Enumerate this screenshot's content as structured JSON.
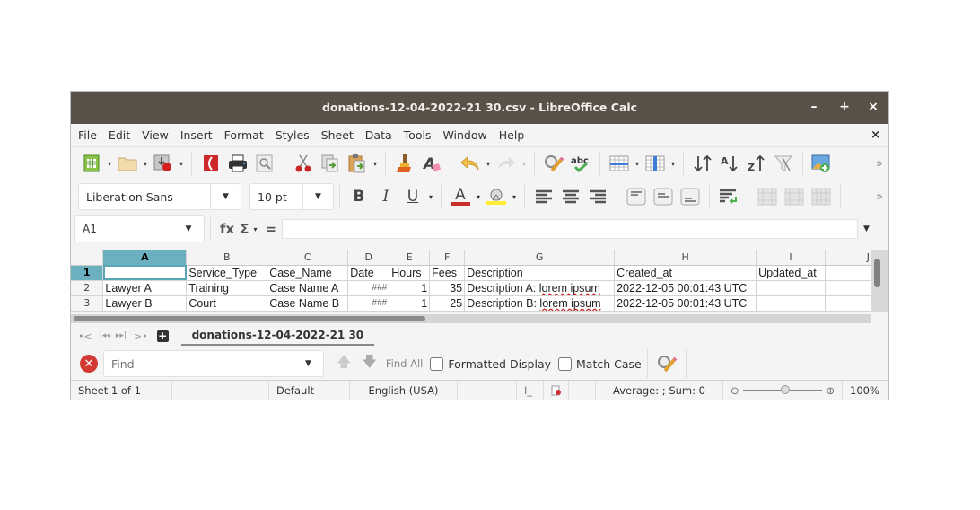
{
  "window": {
    "title": "donations-12-04-2022-21 30.csv - LibreOffice Calc",
    "minimize_label": "–",
    "maximize_label": "+",
    "close_label": "×"
  },
  "menubar": {
    "items": [
      "File",
      "Edit",
      "View",
      "Insert",
      "Format",
      "Styles",
      "Sheet",
      "Data",
      "Tools",
      "Window",
      "Help"
    ],
    "close_doc_label": "×"
  },
  "toolbar": {
    "standard_icons": [
      "new-spreadsheet-icon",
      "open-folder-icon",
      "save-icon",
      "export-pdf-icon",
      "print-icon",
      "print-preview-icon",
      "cut-icon",
      "copy-icon",
      "paste-icon",
      "clone-formatting-icon",
      "clear-formatting-icon",
      "undo-icon",
      "redo-icon",
      "find-replace-icon",
      "spellcheck-icon",
      "row-icon",
      "column-icon",
      "sort-icon",
      "sort-ascending-icon",
      "sort-descending-icon",
      "autofilter-icon",
      "insert-image-icon"
    ],
    "more_label": "»"
  },
  "formatting": {
    "font_name": "Liberation Sans",
    "font_size": "10 pt",
    "bold_label": "B",
    "italic_label": "I",
    "underline_label": "U",
    "font_color_label": "A",
    "font_color": "#c9302c",
    "highlight_color": "#ffee33",
    "more_label": "»"
  },
  "formula_bar": {
    "name_box": "A1",
    "fx_label": "fx",
    "sum_label": "Σ",
    "equals_label": "=",
    "formula": ""
  },
  "sheet": {
    "columns": [
      "A",
      "B",
      "C",
      "D",
      "E",
      "F",
      "G",
      "H",
      "I",
      "J"
    ],
    "rows": [
      {
        "num": "1",
        "cells": [
          "",
          "Service_Type",
          "Case_Name",
          "Date",
          "Hours",
          "Fees",
          "Description",
          "Created_at",
          "Updated_at",
          ""
        ]
      },
      {
        "num": "2",
        "cells": [
          "Lawyer A",
          "Training",
          "Case Name A",
          "###",
          "1",
          "35",
          "Description A: lorem ipsum",
          "2022-12-05 00:01:43 UTC",
          "",
          ""
        ]
      },
      {
        "num": "3",
        "cells": [
          "Lawyer B",
          "Court",
          "Case Name B",
          "###",
          "1",
          "25",
          "Description B: lorem ipsum",
          "2022-12-05 00:01:43 UTC",
          "",
          ""
        ]
      }
    ],
    "active_cell": "A1",
    "selected_column": "A",
    "selected_row": "1",
    "selection_color": "#6ab0be"
  },
  "tabs": {
    "nav": [
      "•<",
      "|◂◂",
      "▸▸|",
      ">•"
    ],
    "add_label": "+",
    "sheets": [
      "donations-12-04-2022-21 30"
    ]
  },
  "findbar": {
    "placeholder": "Find",
    "value": "",
    "find_all_label": "Find All",
    "formatted_display_label": "Formatted Display",
    "match_case_label": "Match Case",
    "formatted_display_checked": false,
    "match_case_checked": false
  },
  "status": {
    "sheet": "Sheet 1 of 1",
    "page_style": "Default",
    "language": "English (USA)",
    "summary": "Average: ; Sum: 0",
    "zoom": "100%",
    "zoom_value": 100
  }
}
